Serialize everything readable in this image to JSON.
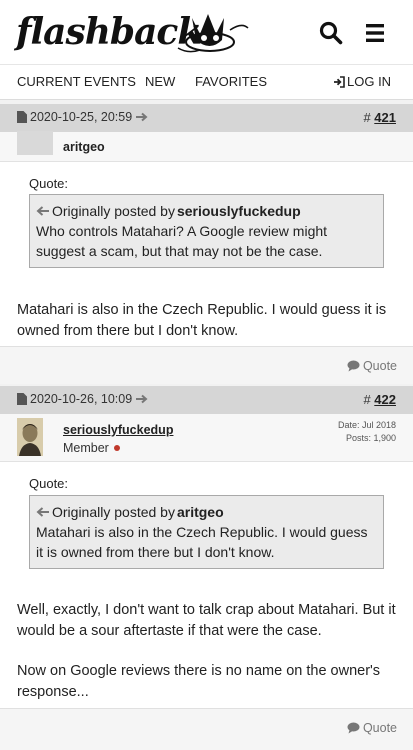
{
  "header": {
    "logo_text": "flashback",
    "colors": {
      "background": "#ffffff",
      "text": "#111111"
    }
  },
  "nav": {
    "items": [
      "CURRENT EVENTS",
      "NEW",
      "FAVORITES"
    ],
    "login_label": "LOG IN"
  },
  "posts": [
    {
      "date": "2020-10-25, 20:59",
      "number_prefix": "#",
      "number": "421",
      "username": "aritgeo",
      "quote_label": "Quote:",
      "quote_prefix": "Originally posted by",
      "quote_author": "seriouslyfuckedup",
      "quote_text": "Who controls Matahari? A Google review might suggest a scam, but that may not be the case.",
      "text_paragraphs": [
        "Matahari is also in the Czech Republic. I would guess it is owned from there but I don't know."
      ],
      "quote_button": "Quote"
    },
    {
      "date": "2020-10-26, 10:09",
      "number_prefix": "#",
      "number": "422",
      "username": "seriouslyfuckedup",
      "user_title": "Member",
      "meta_date": "Date: Jul 2018",
      "meta_posts": "Posts: 1,900",
      "quote_label": "Quote:",
      "quote_prefix": "Originally posted by",
      "quote_author": "aritgeo",
      "quote_text": "Matahari is also in the Czech Republic. I would guess it is owned from there but I don't know.",
      "text_paragraphs": [
        "Well, exactly, I don't want to talk crap about Matahari. But it would be a sour aftertaste if that were the case.",
        "Now on Google reviews there is no name on the owner's response..."
      ],
      "quote_button": "Quote"
    }
  ],
  "colors": {
    "post_header_bg": "#d6d6d6",
    "quote_bg": "#ebebeb",
    "online_dot": "#c0392b"
  }
}
